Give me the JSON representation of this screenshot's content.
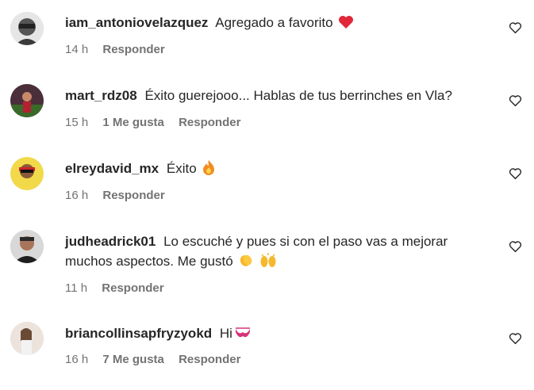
{
  "comments": [
    {
      "username": "iam_antoniovelazquez",
      "text": "Agregado a favorito",
      "emoji": "red-heart",
      "time": "14 h",
      "likes": "",
      "reply": "Responder"
    },
    {
      "username": "mart_rdz08",
      "text": "Éxito guerejooo... Hablas de tus berrinches en Vla?",
      "emoji": "",
      "time": "15 h",
      "likes": "1 Me gusta",
      "reply": "Responder"
    },
    {
      "username": "elreydavid_mx",
      "text": "Éxito",
      "emoji": "fire",
      "time": "16 h",
      "likes": "",
      "reply": "Responder"
    },
    {
      "username": "judheadrick01",
      "text": "Lo escuché y pues si con el paso vas a mejorar muchos aspectos. Me gustó",
      "emoji": "clapping-hands raising-hands",
      "time": "11 h",
      "likes": "",
      "reply": "Responder"
    },
    {
      "username": "briancollinsapfryzyokd",
      "text": "Hi",
      "emoji": "lingerie",
      "time": "16 h",
      "likes": "7 Me gusta",
      "reply": "Responder"
    }
  ],
  "colors": {
    "text": "#262626",
    "meta": "#737373",
    "background": "#ffffff"
  }
}
